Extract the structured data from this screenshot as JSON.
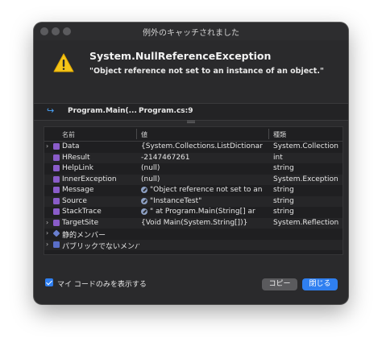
{
  "window": {
    "title": "例外のキャッチされました"
  },
  "exception": {
    "name": "System.NullReferenceException",
    "message": "\"Object reference not set to an instance of an object.\""
  },
  "stack": {
    "method": "Program.Main(...",
    "file": "Program.cs:9"
  },
  "grid": {
    "columns": [
      "名前",
      "値",
      "種類"
    ],
    "rows": [
      {
        "name": "Data",
        "value": "{System.Collections.ListDictionar",
        "type": "System.Collection",
        "expandable": true,
        "icon": "property-icon"
      },
      {
        "name": "HResult",
        "value": "-2147467261",
        "type": "int",
        "expandable": false,
        "icon": "property-icon"
      },
      {
        "name": "HelpLink",
        "value": "(null)",
        "type": "string",
        "expandable": false,
        "icon": "property-icon"
      },
      {
        "name": "InnerException",
        "value": "(null)",
        "type": "System.Exception",
        "expandable": false,
        "icon": "property-icon"
      },
      {
        "name": "Message",
        "value": "\"Object reference not set to an",
        "type": "string",
        "expandable": false,
        "icon": "property-icon",
        "visualizer": true
      },
      {
        "name": "Source",
        "value": "\"InstanceTest\"",
        "type": "string",
        "expandable": false,
        "icon": "property-icon",
        "visualizer": true
      },
      {
        "name": "StackTrace",
        "value": "\"   at Program.Main(String[] ar",
        "type": "string",
        "expandable": false,
        "icon": "property-icon",
        "visualizer": true
      },
      {
        "name": "TargetSite",
        "value": "{Void Main(System.String[])}",
        "type": "System.Reflection",
        "expandable": true,
        "icon": "property-icon"
      },
      {
        "name": "静的メンバー",
        "value": "",
        "type": "",
        "expandable": true,
        "icon": "static-members-icon"
      },
      {
        "name": "パブリックでないメンバー",
        "value": "",
        "type": "",
        "expandable": true,
        "icon": "non-public-members-icon"
      }
    ]
  },
  "footer": {
    "checkbox_label": "マイ コードのみを表示する",
    "checkbox_checked": true,
    "copy_label": "コピー",
    "close_label": "閉じる"
  },
  "colors": {
    "accent": "#2f7ff0",
    "window_bg": "#2a2a2c",
    "warning": "#f5c518"
  }
}
